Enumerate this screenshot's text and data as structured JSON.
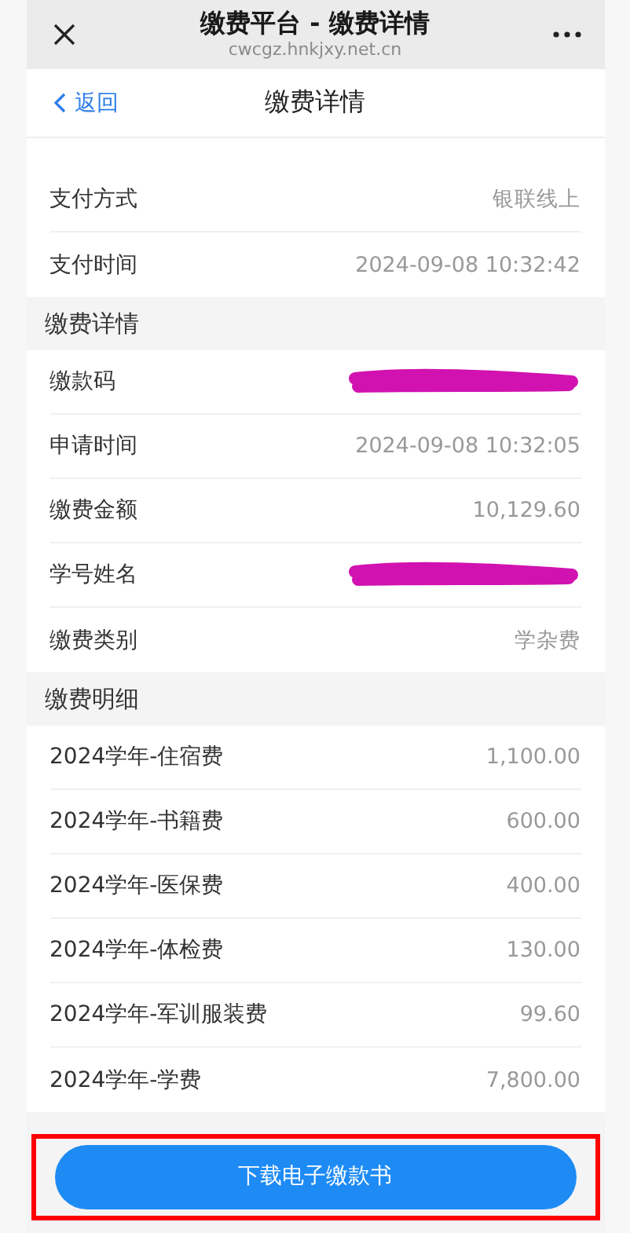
{
  "browser_bar": {
    "title": "缴费平台 - 缴费详情",
    "url": "cwcgz.hnkjxy.net.cn"
  },
  "header": {
    "back": "返回",
    "title": "缴费详情"
  },
  "sections": [
    {
      "rows": [
        {
          "label": "支付方式",
          "value": "银联线上",
          "kind": "text"
        },
        {
          "label": "支付时间",
          "value": "2024-09-08 10:32:42",
          "kind": "text"
        }
      ]
    },
    {
      "title": "缴费详情",
      "rows": [
        {
          "label": "缴款码",
          "kind": "redacted"
        },
        {
          "label": "申请时间",
          "value": "2024-09-08 10:32:05",
          "kind": "text"
        },
        {
          "label": "缴费金额",
          "value": "10,129.60",
          "kind": "text"
        },
        {
          "label": "学号姓名",
          "kind": "redacted"
        },
        {
          "label": "缴费类别",
          "value": "学杂费",
          "kind": "text"
        }
      ]
    },
    {
      "title": "缴费明细",
      "rows": [
        {
          "label": "2024学年-住宿费",
          "value": "1,100.00",
          "kind": "text"
        },
        {
          "label": "2024学年-书籍费",
          "value": "600.00",
          "kind": "text"
        },
        {
          "label": "2024学年-医保费",
          "value": "400.00",
          "kind": "text"
        },
        {
          "label": "2024学年-体检费",
          "value": "130.00",
          "kind": "text"
        },
        {
          "label": "2024学年-军训服装费",
          "value": "99.60",
          "kind": "text"
        },
        {
          "label": "2024学年-学费",
          "value": "7,800.00",
          "kind": "text"
        }
      ]
    }
  ],
  "download_button": {
    "label": "下载电子缴款书",
    "outlined": true
  }
}
